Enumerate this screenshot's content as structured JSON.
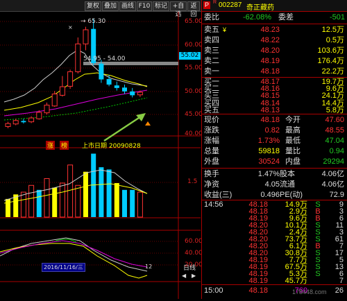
{
  "toolbar": {
    "buttons": [
      "复权",
      "叠加",
      "画线",
      "F10",
      "标记",
      "+自选",
      "返回"
    ],
    "arrow_left": "◀",
    "arrow_right": "▶"
  },
  "header": {
    "badge": "R",
    "code": "002287",
    "name": "奇正藏药",
    "menu_label": "P"
  },
  "chart": {
    "high_label": "65.30",
    "range_label": "54.95 - 54.00",
    "current_price_tag": "55.02",
    "ipo_label": "上市日期  20090828",
    "ipo_badges": [
      "涨",
      "榜"
    ],
    "date_label": "2016/11/16/三",
    "date_right": "12",
    "bottom_tab": "日线",
    "price_axis": [
      "65.00",
      "60.00",
      "55.00",
      "50.00",
      "45.00",
      "40.00"
    ],
    "vol_axis": [
      "1.5"
    ],
    "ind_axis": [
      "60.00",
      "40.00",
      "20.00"
    ],
    "candles": [
      {
        "o": 40.2,
        "c": 40.9,
        "h": 41.3,
        "l": 39.8,
        "up": true
      },
      {
        "o": 40.8,
        "c": 41.6,
        "h": 42.0,
        "l": 40.5,
        "up": true
      },
      {
        "o": 41.5,
        "c": 41.2,
        "h": 42.0,
        "l": 40.9,
        "up": false
      },
      {
        "o": 41.3,
        "c": 42.2,
        "h": 42.6,
        "l": 41.0,
        "up": true
      },
      {
        "o": 42.0,
        "c": 43.5,
        "h": 44.0,
        "l": 41.8,
        "up": true
      },
      {
        "o": 43.4,
        "c": 45.2,
        "h": 45.8,
        "l": 43.0,
        "up": true
      },
      {
        "o": 45.0,
        "c": 47.8,
        "h": 48.5,
        "l": 44.8,
        "up": true
      },
      {
        "o": 47.5,
        "c": 49.5,
        "h": 52.0,
        "l": 47.2,
        "up": true
      },
      {
        "o": 49.6,
        "c": 53.0,
        "h": 53.5,
        "l": 49.0,
        "up": true
      },
      {
        "o": 53.0,
        "c": 59.5,
        "h": 61.0,
        "l": 52.6,
        "up": true
      },
      {
        "o": 59.5,
        "c": 62.8,
        "h": 63.5,
        "l": 58.0,
        "up": true
      },
      {
        "o": 63.0,
        "c": 55.0,
        "h": 65.3,
        "l": 54.5,
        "up": false
      },
      {
        "o": 54.9,
        "c": 51.2,
        "h": 55.8,
        "l": 50.4,
        "up": false
      },
      {
        "o": 51.3,
        "c": 50.0,
        "h": 52.2,
        "l": 49.6,
        "up": false
      },
      {
        "o": 49.8,
        "c": 49.2,
        "h": 50.7,
        "l": 48.6,
        "up": false
      },
      {
        "o": 49.3,
        "c": 48.4,
        "h": 50.0,
        "l": 47.8,
        "up": false
      },
      {
        "o": 48.4,
        "c": 47.5,
        "h": 49.2,
        "l": 47.0,
        "up": false
      },
      {
        "o": 47.6,
        "c": 48.2,
        "h": 48.6,
        "l": 47.1,
        "up": true
      }
    ],
    "volumes": [
      {
        "v": 0.8,
        "c": "yel"
      },
      {
        "v": 1.0,
        "c": "yel"
      },
      {
        "v": 1.1,
        "c": "red"
      },
      {
        "v": 1.4,
        "c": "red"
      },
      {
        "v": 1.2,
        "c": "blue"
      },
      {
        "v": 1.7,
        "c": "red"
      },
      {
        "v": 1.3,
        "c": "yel"
      },
      {
        "v": 1.5,
        "c": "red"
      },
      {
        "v": 2.3,
        "c": "red"
      },
      {
        "v": 1.4,
        "c": "red"
      },
      {
        "v": 2.0,
        "c": "yel"
      },
      {
        "v": 2.8,
        "c": "blue"
      },
      {
        "v": 2.2,
        "c": "blue"
      },
      {
        "v": 2.1,
        "c": "blue"
      },
      {
        "v": 1.5,
        "c": "yel"
      },
      {
        "v": 1.2,
        "c": "blue"
      },
      {
        "v": 1.2,
        "c": "blue"
      },
      {
        "v": 1.1,
        "c": "red"
      }
    ]
  },
  "quote": {
    "weibi_label": "委比",
    "weibi_value": "-62.08%",
    "weicha_label": "委差",
    "weicha_value": "-501",
    "sells": [
      {
        "label": "卖五",
        "mark": "¥",
        "price": "48.23",
        "vol": "12.5万"
      },
      {
        "label": "卖四",
        "mark": "",
        "price": "48.22",
        "vol": "0.5万"
      },
      {
        "label": "卖三",
        "mark": "",
        "price": "48.20",
        "vol": "103.6万"
      },
      {
        "label": "卖二",
        "mark": "",
        "price": "48.19",
        "vol": "176.4万"
      },
      {
        "label": "卖一",
        "mark": "",
        "price": "48.18",
        "vol": "22.2万"
      }
    ],
    "buys": [
      {
        "label": "买一",
        "price": "48.17",
        "vol": "19.7万"
      },
      {
        "label": "买二",
        "price": "48.16",
        "vol": "9.6万"
      },
      {
        "label": "买三",
        "price": "48.15",
        "vol": "24.1万"
      },
      {
        "label": "买四",
        "price": "48.14",
        "vol": "14.4万"
      },
      {
        "label": "买五",
        "price": "48.13",
        "vol": "5.8万"
      }
    ],
    "stats": [
      {
        "l1": "现价",
        "v1": "48.18",
        "l2": "今开",
        "v2": "47.60",
        "c1": "red",
        "c2": "red"
      },
      {
        "l1": "涨跌",
        "v1": "0.82",
        "l2": "最高",
        "v2": "48.55",
        "c1": "red",
        "c2": "red"
      },
      {
        "l1": "涨幅",
        "v1": "1.73%",
        "l2": "最低",
        "v2": "47.04",
        "c1": "red",
        "c2": "grn"
      },
      {
        "l1": "总量",
        "v1": "59818",
        "l2": "量比",
        "v2": "0.94",
        "c1": "yel",
        "c2": "grn"
      },
      {
        "l1": "外盘",
        "v1": "30524",
        "l2": "内盘",
        "v2": "29294",
        "c1": "red",
        "c2": "grn"
      }
    ],
    "fund": [
      {
        "l1": "换手",
        "v1": "1.47%",
        "l2": "股本",
        "v2": "4.06亿"
      },
      {
        "l1": "净资",
        "v1": "4.05",
        "l2": "流通",
        "v2": "4.06亿"
      },
      {
        "l1": "收益(三)",
        "v1": "0.496",
        "l2": "PE(动)",
        "v2": "72.9"
      }
    ]
  },
  "ticks": [
    {
      "time": "14:56",
      "price": "48.18",
      "vol": "14.9万",
      "bs": "S",
      "n": "9"
    },
    {
      "time": "",
      "price": "48.18",
      "vol": "2.9万",
      "bs": "B",
      "n": "3"
    },
    {
      "time": "",
      "price": "48.19",
      "vol": "9.6万",
      "bs": "B",
      "n": "6"
    },
    {
      "time": "",
      "price": "48.20",
      "vol": "10.1万",
      "bs": "S",
      "n": "11"
    },
    {
      "time": "",
      "price": "48.20",
      "vol": "2.4万",
      "bs": "S",
      "n": "3"
    },
    {
      "time": "",
      "price": "48.20",
      "vol": "73.7万",
      "bs": "S",
      "n": "61"
    },
    {
      "time": "",
      "price": "48.20",
      "vol": "6.1万",
      "bs": "B",
      "n": "7"
    },
    {
      "time": "",
      "price": "48.20",
      "vol": "30.8万",
      "bs": "S",
      "n": "17"
    },
    {
      "time": "",
      "price": "48.19",
      "vol": "7.7万",
      "bs": "S",
      "n": "5"
    },
    {
      "time": "",
      "price": "48.19",
      "vol": "67.5万",
      "bs": "S",
      "n": "13"
    },
    {
      "time": "",
      "price": "48.19",
      "vol": "5.3万",
      "bs": "S",
      "n": "6"
    },
    {
      "time": "",
      "price": "48.19",
      "vol": "45.7万",
      "bs": "",
      "n": "7"
    }
  ],
  "final_tick": {
    "time": "15:00",
    "price": "48.18",
    "vol": "760",
    "n": "26"
  },
  "watermark": "178448.com"
}
